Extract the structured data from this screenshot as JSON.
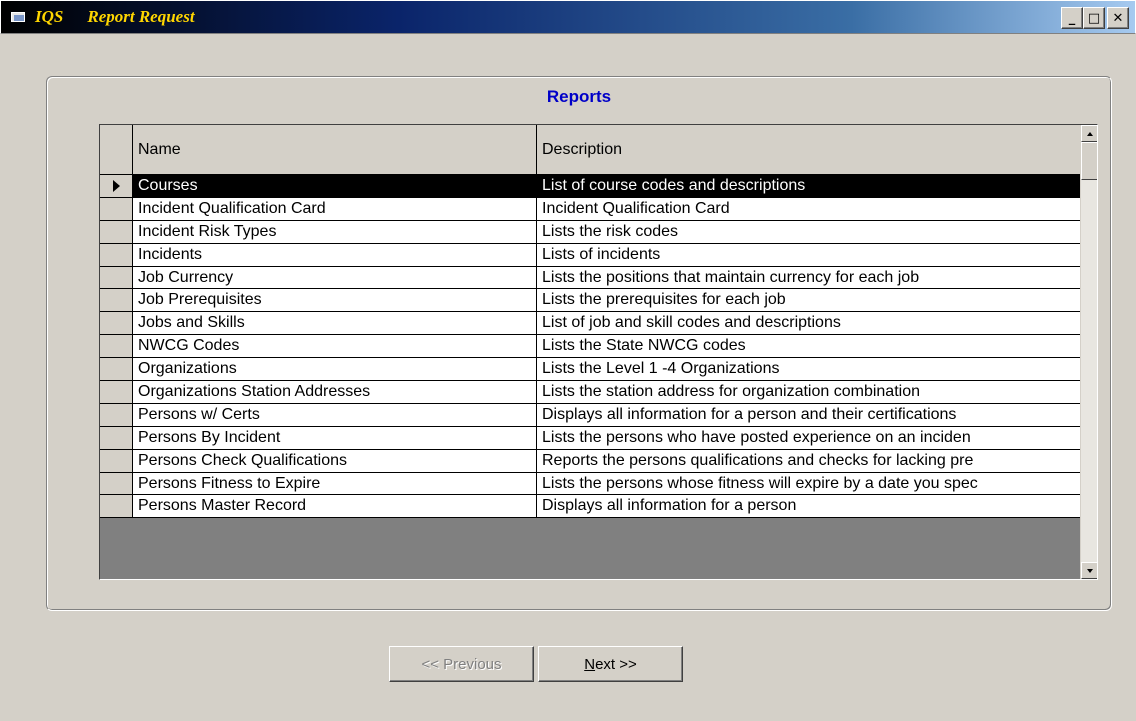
{
  "window": {
    "app_name": "IQS",
    "title": "Report Request",
    "controls": {
      "minimize": "_",
      "maximize": "□",
      "close": "✕"
    }
  },
  "reports": {
    "frame_title": "Reports",
    "columns": {
      "name": "Name",
      "description": "Description"
    },
    "selected_index": 0,
    "rows": [
      {
        "name": "Courses",
        "description": "List of course codes and descriptions"
      },
      {
        "name": "Incident Qualification Card",
        "description": "Incident Qualification Card"
      },
      {
        "name": "Incident Risk Types",
        "description": "Lists the risk codes"
      },
      {
        "name": "Incidents",
        "description": "Lists of incidents"
      },
      {
        "name": "Job Currency",
        "description": "Lists the positions that maintain currency for each job"
      },
      {
        "name": "Job Prerequisites",
        "description": "Lists the prerequisites for each job"
      },
      {
        "name": "Jobs and Skills",
        "description": "List of job and skill codes and descriptions"
      },
      {
        "name": "NWCG Codes",
        "description": "Lists the State NWCG codes"
      },
      {
        "name": "Organizations",
        "description": "Lists the Level 1 -4 Organizations"
      },
      {
        "name": "Organizations Station Addresses",
        "description": "Lists the station address for organization combination"
      },
      {
        "name": "Persons  w/ Certs",
        "description": "Displays all information for a person and their certifications"
      },
      {
        "name": "Persons By Incident",
        "description": "Lists the persons who have posted experience on an inciden"
      },
      {
        "name": "Persons Check Qualifications",
        "description": "Reports the persons qualifications and checks for lacking pre"
      },
      {
        "name": "Persons Fitness to Expire",
        "description": "Lists the persons whose fitness will expire by a date you spec"
      },
      {
        "name": "Persons Master Record",
        "description": "Displays all information for a person"
      }
    ]
  },
  "buttons": {
    "previous": "<< Previous",
    "next": "Next >>"
  },
  "colors": {
    "title_text": "#ffd600",
    "frame_title": "#0000c8",
    "selected_row_bg": "#000000",
    "window_bg": "#d4d0c8"
  }
}
